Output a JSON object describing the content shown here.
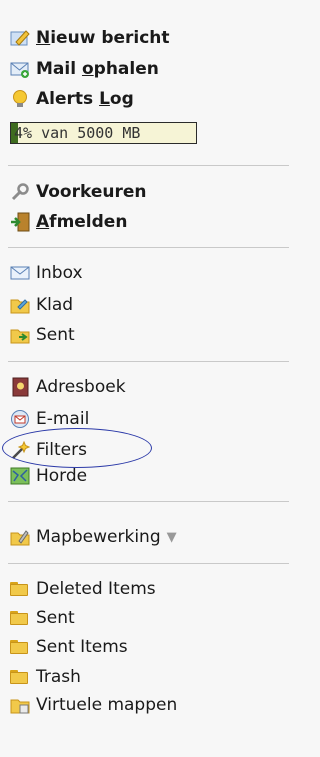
{
  "menu": {
    "new_message_u": "N",
    "new_message_rest": "ieuw bericht",
    "fetch_mail_pre": "Mail ",
    "fetch_mail_u": "o",
    "fetch_mail_post": "phalen",
    "alerts_pre": "Alerts ",
    "alerts_u": "L",
    "alerts_post": "og"
  },
  "quota": {
    "text": "4% van 5000 MB",
    "percent": 4
  },
  "account": {
    "preferences": "Voorkeuren",
    "logout_u": "A",
    "logout_rest": "fmelden"
  },
  "mailboxes": [
    "Inbox",
    "Klad",
    "Sent"
  ],
  "apps": {
    "addressbook": "Adresboek",
    "email": "E-mail",
    "filters": "Filters",
    "horde": "Horde"
  },
  "folder_manager": "Mapbewerking",
  "folders": [
    "Deleted Items",
    "Sent",
    "Sent Items",
    "Trash",
    "Virtuele mappen"
  ],
  "colors": {
    "highlight_circle": "#2c3aa8",
    "quota_fill": "#3e6b1f"
  }
}
